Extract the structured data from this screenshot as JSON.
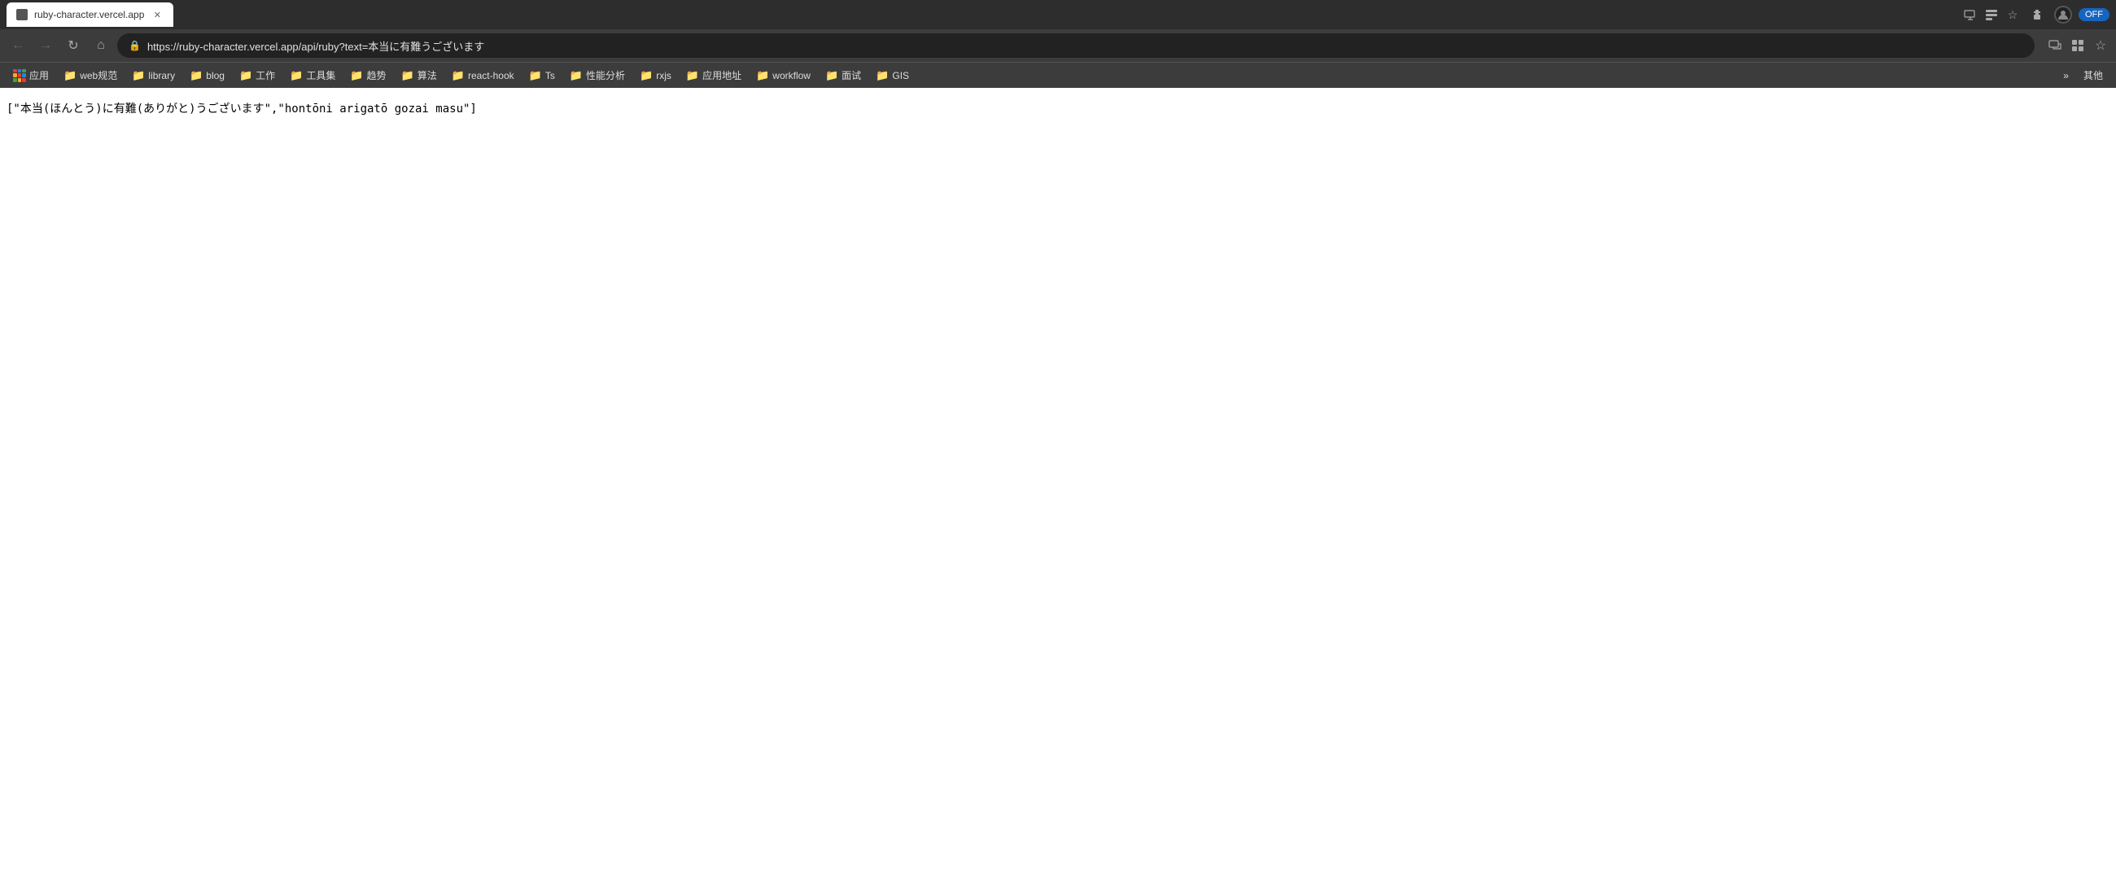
{
  "browser": {
    "tab": {
      "title": "ruby-character.vercel.app",
      "favicon": "🔒"
    },
    "address": "https://ruby-character.vercel.app/api/ruby?text=本当に有難うございます",
    "address_display": "https://ruby-character.vercel.app/api/ruby?text=本当に有難うございます"
  },
  "nav": {
    "back_label": "←",
    "forward_label": "→",
    "refresh_label": "↻",
    "home_label": "⌂"
  },
  "bookmarks": [
    {
      "id": "apps",
      "label": "应用",
      "type": "apps"
    },
    {
      "id": "web-standards",
      "label": "web规范",
      "type": "folder"
    },
    {
      "id": "library",
      "label": "library",
      "type": "folder"
    },
    {
      "id": "blog",
      "label": "blog",
      "type": "folder"
    },
    {
      "id": "work",
      "label": "工作",
      "type": "folder"
    },
    {
      "id": "tools",
      "label": "工具集",
      "type": "folder"
    },
    {
      "id": "trends",
      "label": "趋势",
      "type": "folder"
    },
    {
      "id": "algorithms",
      "label": "算法",
      "type": "folder"
    },
    {
      "id": "react-hook",
      "label": "react-hook",
      "type": "folder"
    },
    {
      "id": "ts",
      "label": "Ts",
      "type": "folder"
    },
    {
      "id": "perf",
      "label": "性能分析",
      "type": "folder"
    },
    {
      "id": "rxjs",
      "label": "rxjs",
      "type": "folder"
    },
    {
      "id": "address",
      "label": "应用地址",
      "type": "folder"
    },
    {
      "id": "workflow",
      "label": "workflow",
      "type": "folder"
    },
    {
      "id": "interview",
      "label": "面试",
      "type": "folder"
    },
    {
      "id": "gis",
      "label": "GIS",
      "type": "folder"
    }
  ],
  "bookmarks_more": "»",
  "other_bookmarks_label": "其他",
  "page": {
    "content": "[\"本当(ほんとう)に有難(ありがと)うございます\",\"hontōni arigatō gozai masu\"]"
  }
}
